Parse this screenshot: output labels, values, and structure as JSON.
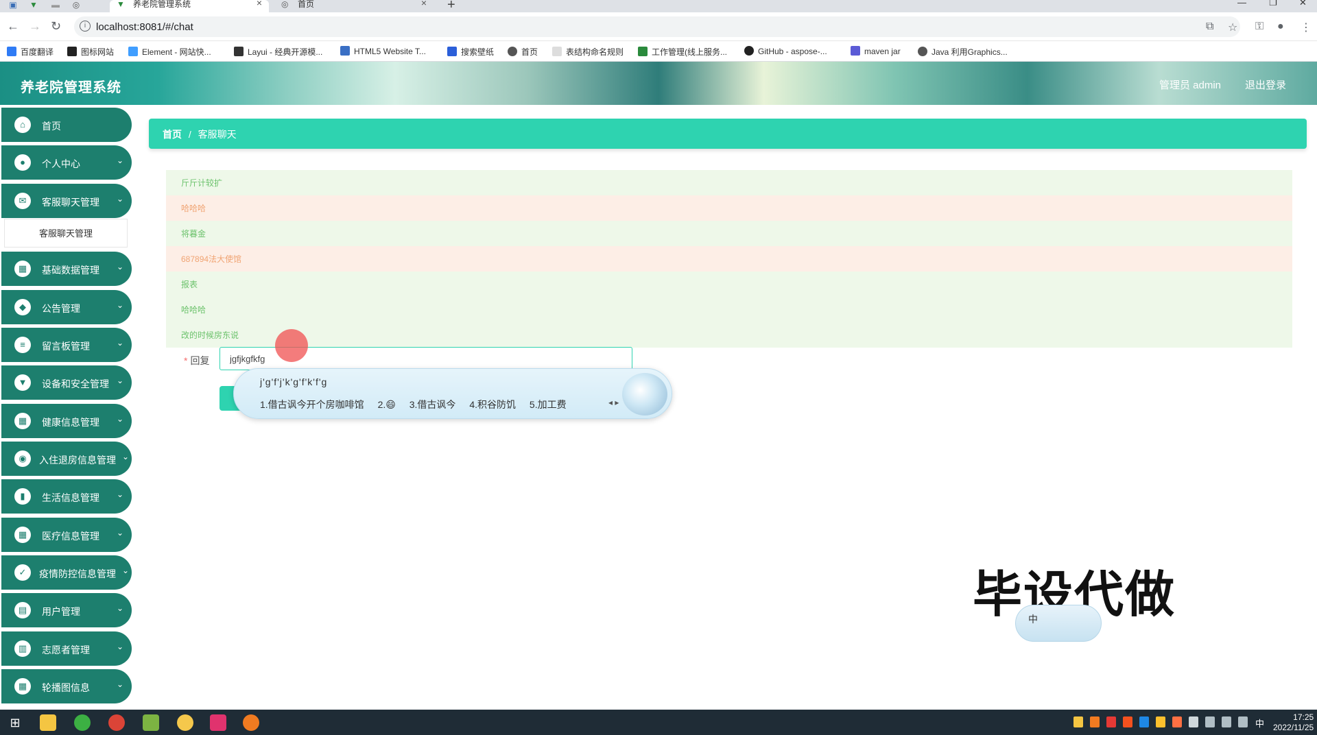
{
  "browser": {
    "tabs": [
      {
        "label": "养老院管理系统",
        "active": true
      },
      {
        "label": "首页",
        "active": false
      }
    ],
    "url": "localhost:8081/#/chat",
    "bookmarks": [
      {
        "label": "百度翻译",
        "color": "#2f7bf5"
      },
      {
        "label": "图标网站",
        "color": "#222222"
      },
      {
        "label": "Element - 网站快...",
        "color": "#409eff"
      },
      {
        "label": "Layui - 经典开源模...",
        "color": "#333333"
      },
      {
        "label": "HTML5 Website T...",
        "color": "#3a6fc4"
      },
      {
        "label": "搜索壁纸",
        "color": "#2b5fd9"
      },
      {
        "label": "首页",
        "color": "#555555"
      },
      {
        "label": "表结构命名规则",
        "color": "#dddddd"
      },
      {
        "label": "工作管理(线上服务...",
        "color": "#2a8a3c"
      },
      {
        "label": "GitHub - aspose-...",
        "color": "#222222"
      },
      {
        "label": "maven jar",
        "color": "#5b5bd6"
      },
      {
        "label": "Java 利用Graphics...",
        "color": "#555555"
      }
    ]
  },
  "header": {
    "title": "养老院管理系统",
    "user": "管理员 admin",
    "logout": "退出登录"
  },
  "sidebar": {
    "items": [
      {
        "label": "首页",
        "icon": "home-icon",
        "glyph": "⌂",
        "has_arrow": false
      },
      {
        "label": "个人中心",
        "icon": "user-icon",
        "glyph": "●",
        "has_arrow": true
      },
      {
        "label": "客服聊天管理",
        "icon": "chat-icon",
        "glyph": "✉",
        "has_arrow": true
      },
      {
        "label": "基础数据管理",
        "icon": "grid-icon",
        "glyph": "▦",
        "has_arrow": true
      },
      {
        "label": "公告管理",
        "icon": "notice-icon",
        "glyph": "◆",
        "has_arrow": true
      },
      {
        "label": "留言板管理",
        "icon": "list-icon",
        "glyph": "≡",
        "has_arrow": true
      },
      {
        "label": "设备和安全管理",
        "icon": "device-icon",
        "glyph": "▼",
        "has_arrow": true
      },
      {
        "label": "健康信息管理",
        "icon": "grid-icon",
        "glyph": "▦",
        "has_arrow": true
      },
      {
        "label": "入住退房信息管理",
        "icon": "location-icon",
        "glyph": "◉",
        "has_arrow": true
      },
      {
        "label": "生活信息管理",
        "icon": "book-icon",
        "glyph": "▮",
        "has_arrow": true
      },
      {
        "label": "医疗信息管理",
        "icon": "grid-icon",
        "glyph": "▦",
        "has_arrow": true
      },
      {
        "label": "疫情防控信息管理",
        "icon": "check-icon",
        "glyph": "✓",
        "has_arrow": true
      },
      {
        "label": "用户管理",
        "icon": "users-icon",
        "glyph": "▤",
        "has_arrow": true
      },
      {
        "label": "志愿者管理",
        "icon": "doc-icon",
        "glyph": "▥",
        "has_arrow": true
      },
      {
        "label": "轮播图信息",
        "icon": "grid-icon",
        "glyph": "▦",
        "has_arrow": true
      }
    ],
    "submenu_label": "客服聊天管理"
  },
  "breadcrumb": {
    "home": "首页",
    "sep": "/",
    "current": "客服聊天"
  },
  "chat": {
    "messages": [
      {
        "text": "斤斤计较扩",
        "side": "left"
      },
      {
        "text": "哈哈哈",
        "side": "right"
      },
      {
        "text": "将暮金",
        "side": "left"
      },
      {
        "text": "687894法大使馆",
        "side": "right"
      },
      {
        "text": "报表",
        "side": "left"
      },
      {
        "text": "哈哈哈",
        "side": "left"
      },
      {
        "text": "改的时候房东说",
        "side": "left"
      }
    ],
    "reply_label": "回复",
    "reply_value": "jgfjkgfkfg"
  },
  "ime": {
    "pinyin": "j'g'f'j'k'g'f'k'f'g",
    "candidates": [
      "1.借古讽今开个房咖啡馆",
      "2.😄",
      "3.借古讽今",
      "4.积谷防饥",
      "5.加工费"
    ]
  },
  "overlay": {
    "watermark": "毕设代做",
    "ime_widget": "中"
  },
  "taskbar": {
    "time": "17:25",
    "date": "2022/11/25",
    "ime_indicator": "中",
    "apps": [
      {
        "name": "explorer",
        "color": "#f4c542"
      },
      {
        "name": "app-green",
        "color": "#3cb043"
      },
      {
        "name": "chrome",
        "color": "#db4437"
      },
      {
        "name": "notepad",
        "color": "#7cb342"
      },
      {
        "name": "app-yellow",
        "color": "#f5c84c"
      },
      {
        "name": "intellij",
        "color": "#e0336e"
      },
      {
        "name": "app-orange",
        "color": "#f07b21"
      }
    ]
  },
  "colors": {
    "sidebar_item": "#1d7f6e",
    "accent": "#2ed3b0",
    "msg_left_text": "#6cc26c",
    "msg_right_text": "#f0a473"
  }
}
